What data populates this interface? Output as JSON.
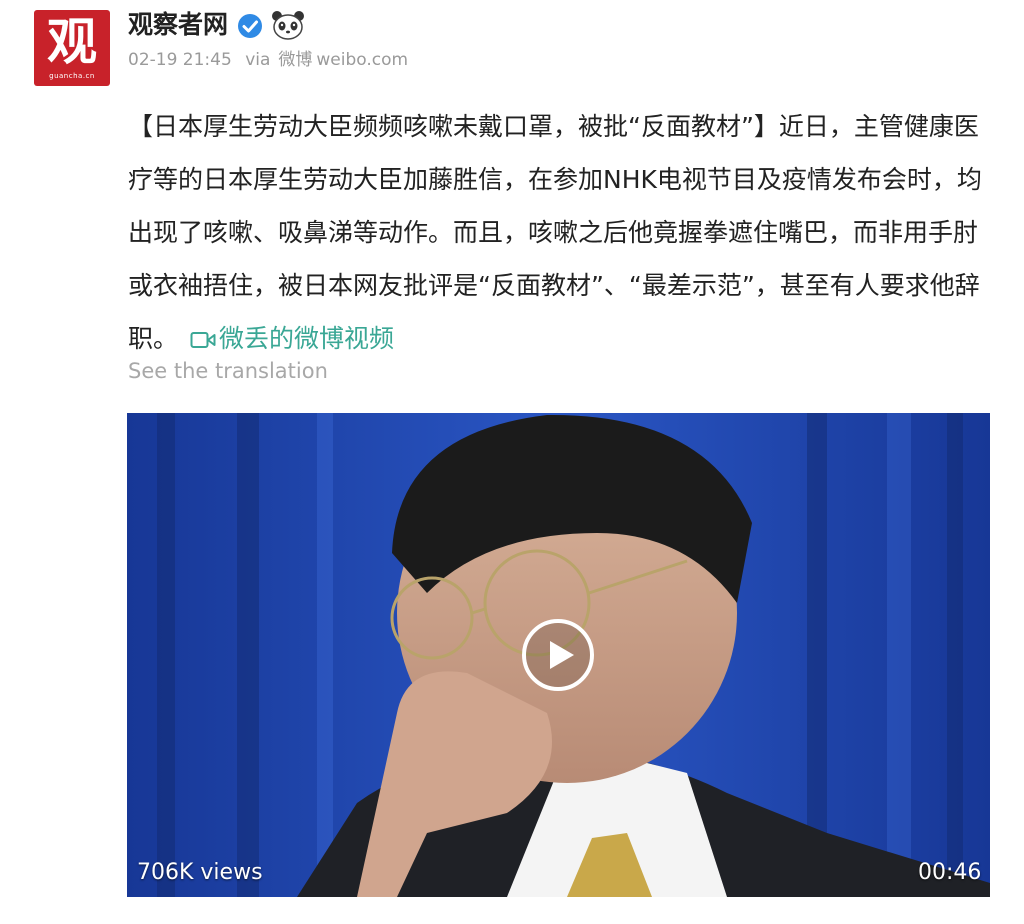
{
  "post": {
    "author": "观察者网",
    "avatar_text": "观",
    "avatar_site": "guancha.cn",
    "verified_icon": "verified-badge-icon",
    "emoji_icon": "panda-icon",
    "timestamp": "02-19 21:45",
    "source_prefix": "via",
    "source_name": "微博",
    "source_domain": "weibo.com",
    "text": "【日本厚生劳动大臣频频咳嗽未戴口罩，被批“反面教材”】近日，主管健康医疗等的日本厚生劳动大臣加藤胜信，在参加NHK电视节目及疫情发布会时，均出现了咳嗽、吸鼻涕等动作。而且，咳嗽之后他竟握拳遮住嘴巴，而非用手肘或衣袖捂住，被日本网友批评是“反面教材”、“最差示范”，甚至有人要求他辞职。",
    "video_link_label": "微丢的微博视频",
    "translate_label": "See the translation"
  },
  "video": {
    "views": "706K views",
    "duration": "00:46",
    "play_icon": "play-icon"
  },
  "colors": {
    "link": "#3aa795",
    "avatar_bg": "#c8222a",
    "verified": "#2f8ae5",
    "meta": "#9a9a9a"
  }
}
